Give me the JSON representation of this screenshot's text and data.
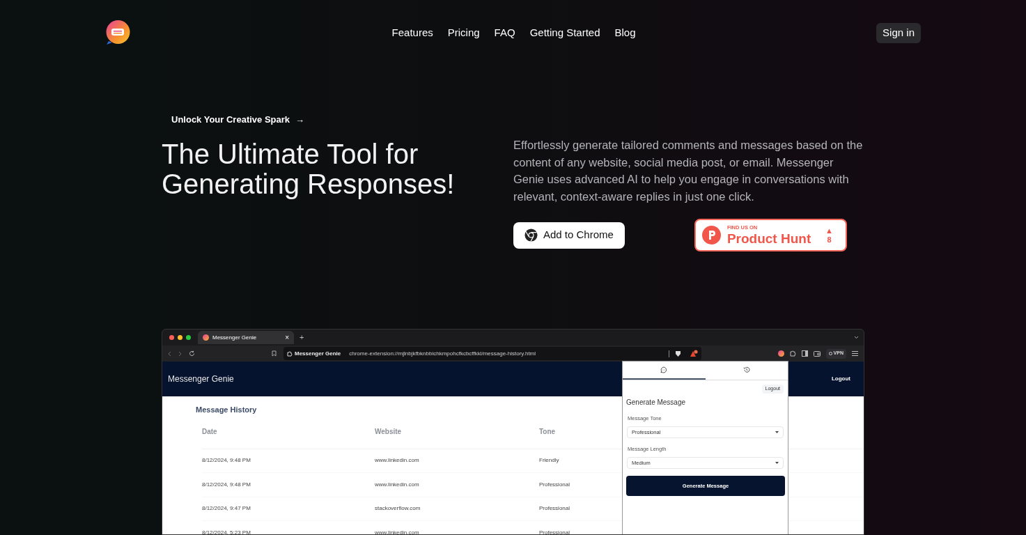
{
  "nav": {
    "links": [
      "Features",
      "Pricing",
      "FAQ",
      "Getting Started",
      "Blog"
    ],
    "sign_in": "Sign in"
  },
  "hero": {
    "eyebrow": "Unlock Your Creative Spark",
    "eyebrow_arrow": "→",
    "title_lines": [
      "The Ultimate Tool for",
      "Generating Responses!"
    ],
    "description": "Effortlessly generate tailored comments and messages based on the content of any website, social media post, or email. Messenger Genie uses advanced AI to help you engage in conversations with relevant, context-aware replies in just one click.",
    "cta": "Add to Chrome",
    "product_hunt": {
      "kicker": "FIND US ON",
      "name": "Product Hunt",
      "upvote_arrow": "▲",
      "count": "8"
    }
  },
  "browser": {
    "tab_title": "Messenger Genie",
    "tab_close": "×",
    "new_tab": "+",
    "site_name": "Messenger Genie",
    "url": "chrome-extension://mjlnbjkfbknbbichkmpohcfkcbcffkkl/message-history.html",
    "vpn": "VPN"
  },
  "app": {
    "brand": "Messenger Genie",
    "logout": "Logout",
    "heading": "Message History",
    "columns": [
      "Date",
      "Website",
      "Tone"
    ],
    "rows": [
      {
        "date": "8/12/2024, 9:48 PM",
        "website": "www.linkedin.com",
        "tone": "Friendly"
      },
      {
        "date": "8/12/2024, 9:48 PM",
        "website": "www.linkedin.com",
        "tone": "Professional"
      },
      {
        "date": "8/12/2024, 9:47 PM",
        "website": "stackoverflow.com",
        "tone": "Professional"
      },
      {
        "date": "8/12/2024, 5:23 PM",
        "website": "www.linkedin.com",
        "tone": "Professional"
      }
    ]
  },
  "popup": {
    "tabs": [
      {
        "kind": "chat",
        "selected": true
      },
      {
        "kind": "history",
        "selected": false
      }
    ],
    "logout": "Logout",
    "title": "Generate Message",
    "fields": [
      {
        "label": "Message Tone",
        "value": "Professional"
      },
      {
        "label": "Message Length",
        "value": "Medium"
      }
    ],
    "button": "Generate Message"
  }
}
